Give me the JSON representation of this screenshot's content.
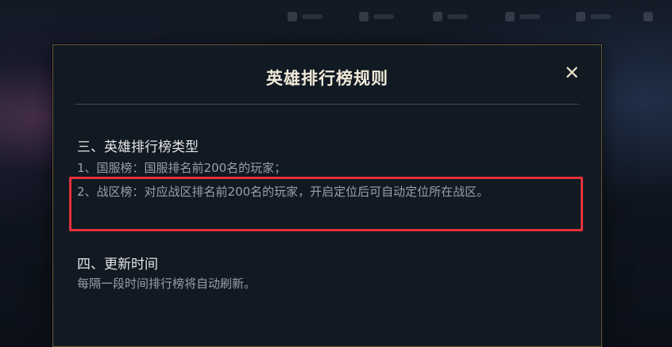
{
  "background_nav": {
    "items": [
      "",
      "",
      "",
      "",
      "",
      "",
      ""
    ]
  },
  "modal": {
    "title": "英雄排行榜规则",
    "close_symbol": "✕",
    "sections": [
      {
        "heading": "三、英雄排行榜类型",
        "lines": [
          "1、国服榜：国服排名前200名的玩家；",
          "2、战区榜：对应战区排名前200名的玩家，开启定位后可自动定位所在战区。"
        ]
      },
      {
        "heading": "四、更新时间",
        "lines": [
          "每隔一段时间排行榜将自动刷新。"
        ]
      }
    ]
  },
  "colors": {
    "border_gold": "#6d5a35",
    "highlight_red": "#e5313a",
    "title_text": "#f0ead8",
    "body_text": "#9aa0a8"
  }
}
